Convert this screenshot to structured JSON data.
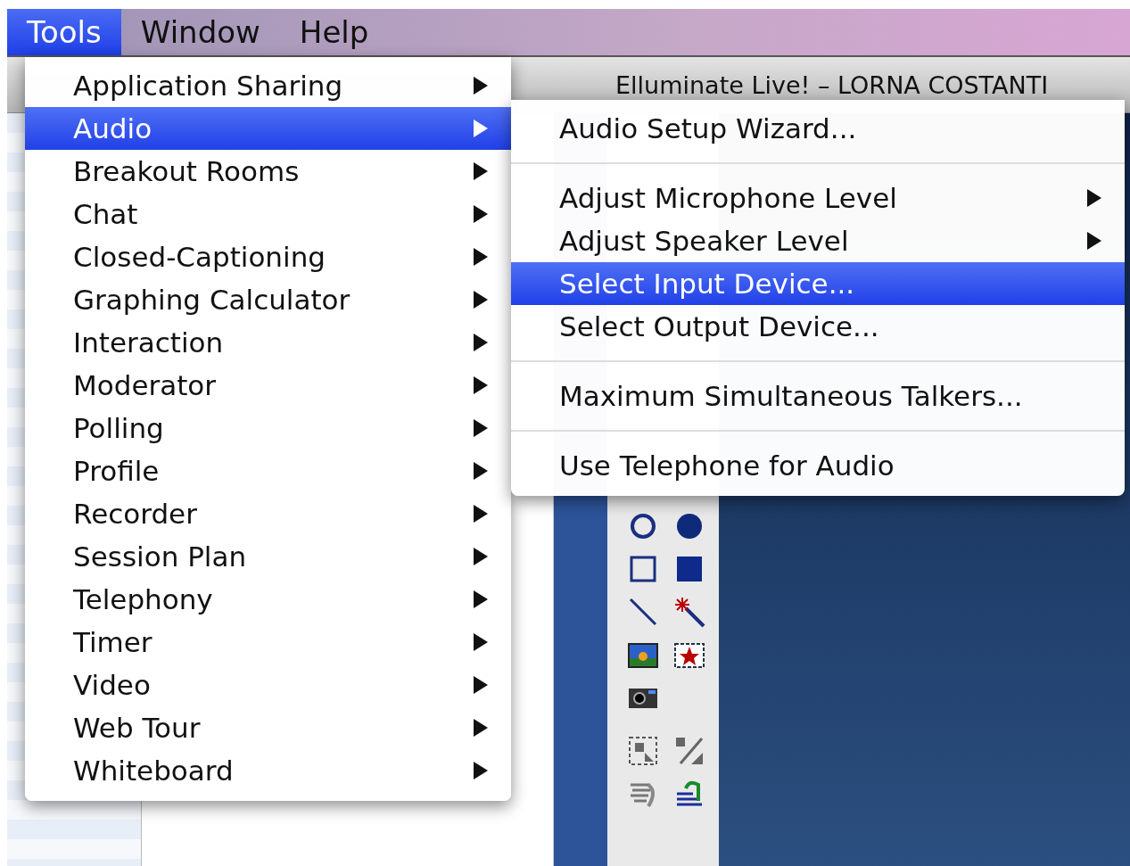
{
  "menu_bar": [
    {
      "label": "Tools",
      "selected": true
    },
    {
      "label": "Window",
      "selected": false
    },
    {
      "label": "Help",
      "selected": false
    }
  ],
  "window": {
    "title": "Elluminate Live! – LORNA COSTANTI"
  },
  "tools_menu": {
    "sections": [
      [
        {
          "label": "Application Sharing",
          "selected": false,
          "has_submenu": true
        },
        {
          "label": "Audio",
          "selected": true,
          "has_submenu": true
        },
        {
          "label": "Breakout Rooms",
          "selected": false,
          "has_submenu": true
        },
        {
          "label": "Chat",
          "selected": false,
          "has_submenu": true
        },
        {
          "label": "Closed-Captioning",
          "selected": false,
          "has_submenu": true
        },
        {
          "label": "Graphing Calculator",
          "selected": false,
          "has_submenu": true
        },
        {
          "label": "Interaction",
          "selected": false,
          "has_submenu": true
        },
        {
          "label": "Moderator",
          "selected": false,
          "has_submenu": true
        },
        {
          "label": "Polling",
          "selected": false,
          "has_submenu": true
        },
        {
          "label": "Profile",
          "selected": false,
          "has_submenu": true
        },
        {
          "label": "Recorder",
          "selected": false,
          "has_submenu": true
        },
        {
          "label": "Session Plan",
          "selected": false,
          "has_submenu": true
        },
        {
          "label": "Telephony",
          "selected": false,
          "has_submenu": true
        },
        {
          "label": "Timer",
          "selected": false,
          "has_submenu": true
        },
        {
          "label": "Video",
          "selected": false,
          "has_submenu": true
        },
        {
          "label": "Web Tour",
          "selected": false,
          "has_submenu": true
        },
        {
          "label": "Whiteboard",
          "selected": false,
          "has_submenu": true
        }
      ]
    ]
  },
  "audio_submenu": {
    "sections": [
      [
        {
          "label": "Audio Setup Wizard...",
          "selected": false,
          "has_submenu": false
        }
      ],
      [
        {
          "label": "Adjust Microphone Level",
          "selected": false,
          "has_submenu": true
        },
        {
          "label": "Adjust Speaker Level",
          "selected": false,
          "has_submenu": true
        },
        {
          "label": "Select Input Device...",
          "selected": true,
          "has_submenu": false
        },
        {
          "label": "Select Output Device...",
          "selected": false,
          "has_submenu": false
        }
      ],
      [
        {
          "label": "Maximum Simultaneous Talkers...",
          "selected": false,
          "has_submenu": false
        }
      ],
      [
        {
          "label": "Use Telephone for Audio",
          "selected": false,
          "has_submenu": false
        }
      ]
    ]
  }
}
